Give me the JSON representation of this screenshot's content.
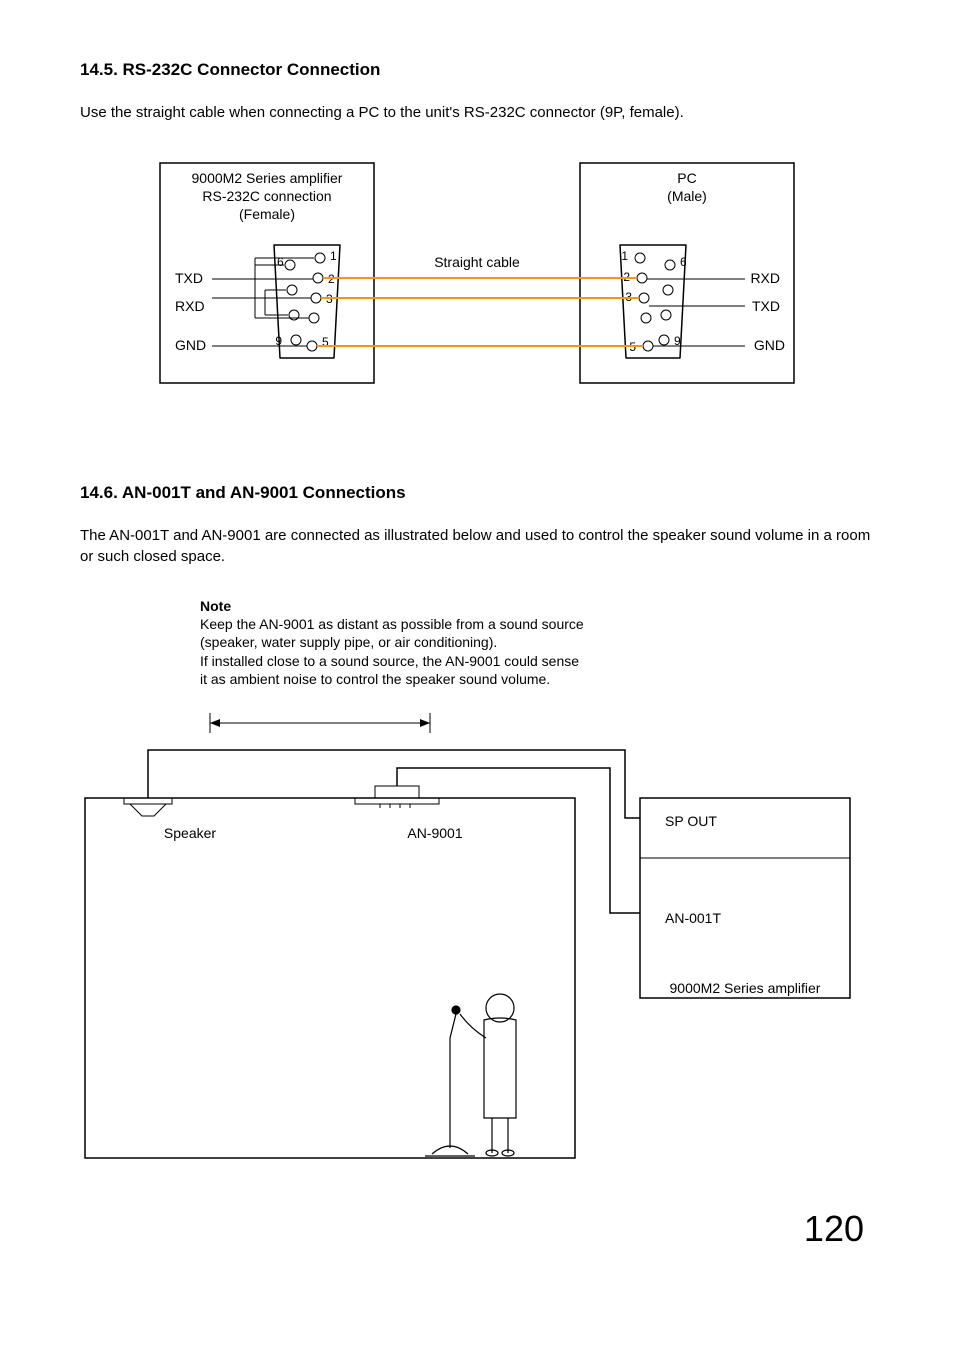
{
  "section1": {
    "heading": "14.5. RS-232C Connector Connection",
    "text": "Use the straight cable when connecting a PC to the unit's RS-232C connector (9P, female).",
    "left_box_line1": "9000M2 Series amplifier",
    "left_box_line2": "RS-232C connection",
    "left_box_line3": "(Female)",
    "right_box_line1": "PC",
    "right_box_line2": "(Male)",
    "cable_label": "Straight cable",
    "left_txd": "TXD",
    "left_rxd": "RXD",
    "left_gnd": "GND",
    "right_rxd": "RXD",
    "right_txd": "TXD",
    "right_gnd": "GND",
    "pin1": "1",
    "pin2": "2",
    "pin3": "3",
    "pin5": "5",
    "pin6": "6",
    "pin9": "9"
  },
  "section2": {
    "heading": "14.6. AN-001T and AN-9001 Connections",
    "text": "The AN-001T and AN-9001 are connected as illustrated below and used to control the speaker sound volume in a room or such closed space.",
    "note_title": "Note",
    "note_line1": "Keep the AN-9001 as distant as possible from a sound source",
    "note_line2": "(speaker, water supply pipe, or air conditioning).",
    "note_line3": "If installed close to a sound source, the AN-9001 could sense",
    "note_line4": "it as ambient noise to control the speaker sound volume.",
    "speaker_label": "Speaker",
    "an9001_label": "AN-9001",
    "spout_label": "SP OUT",
    "an001t_label": "AN-001T",
    "amp_label": "9000M2 Series amplifier"
  },
  "page_number": "120"
}
